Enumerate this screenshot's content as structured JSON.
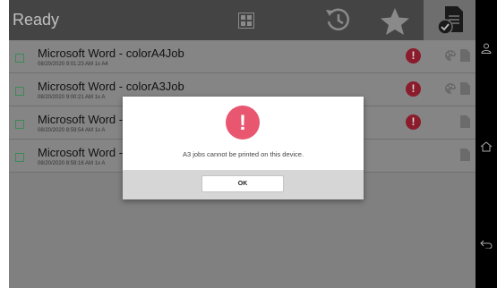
{
  "header": {
    "title": "Ready",
    "tabs": [
      {
        "icon": "grid-icon"
      },
      {
        "icon": "history-icon"
      },
      {
        "icon": "star-icon"
      },
      {
        "icon": "document-check-icon",
        "selected": true
      }
    ]
  },
  "jobs": [
    {
      "name": "Microsoft Word - colorA4Job",
      "meta": "08/20/2020 9:01:23 AM 1x A4",
      "alert": true,
      "color": true
    },
    {
      "name": "Microsoft Word - colorA3Job",
      "meta": "08/20/2020 9:00:21 AM 1x A",
      "alert": true,
      "color": true
    },
    {
      "name": "Microsoft Word -",
      "meta": "08/20/2020 8:59:54 AM 1x A",
      "alert": true,
      "color": false
    },
    {
      "name": "Microsoft Word -",
      "meta": "08/20/2020 8:59:16 AM 1x A",
      "alert": false,
      "color": false
    }
  ],
  "dialog": {
    "icon_glyph": "!",
    "message": "A3 jobs cannot be printed on this device.",
    "ok_label": "OK"
  },
  "alert_glyph": "!",
  "colors": {
    "accent": "#e8566f",
    "alert_dim": "#8b1c2c",
    "checkbox": "#3a8a5a",
    "topbar": "#444444"
  }
}
